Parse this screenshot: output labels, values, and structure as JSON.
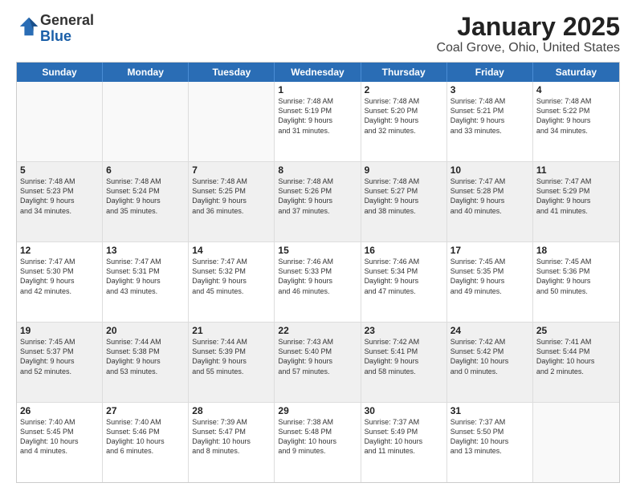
{
  "header": {
    "logo_general": "General",
    "logo_blue": "Blue",
    "title": "January 2025",
    "subtitle": "Coal Grove, Ohio, United States"
  },
  "calendar": {
    "days_of_week": [
      "Sunday",
      "Monday",
      "Tuesday",
      "Wednesday",
      "Thursday",
      "Friday",
      "Saturday"
    ],
    "rows": [
      [
        {
          "day": "",
          "lines": []
        },
        {
          "day": "",
          "lines": []
        },
        {
          "day": "",
          "lines": []
        },
        {
          "day": "1",
          "lines": [
            "Sunrise: 7:48 AM",
            "Sunset: 5:19 PM",
            "Daylight: 9 hours",
            "and 31 minutes."
          ]
        },
        {
          "day": "2",
          "lines": [
            "Sunrise: 7:48 AM",
            "Sunset: 5:20 PM",
            "Daylight: 9 hours",
            "and 32 minutes."
          ]
        },
        {
          "day": "3",
          "lines": [
            "Sunrise: 7:48 AM",
            "Sunset: 5:21 PM",
            "Daylight: 9 hours",
            "and 33 minutes."
          ]
        },
        {
          "day": "4",
          "lines": [
            "Sunrise: 7:48 AM",
            "Sunset: 5:22 PM",
            "Daylight: 9 hours",
            "and 34 minutes."
          ]
        }
      ],
      [
        {
          "day": "5",
          "lines": [
            "Sunrise: 7:48 AM",
            "Sunset: 5:23 PM",
            "Daylight: 9 hours",
            "and 34 minutes."
          ]
        },
        {
          "day": "6",
          "lines": [
            "Sunrise: 7:48 AM",
            "Sunset: 5:24 PM",
            "Daylight: 9 hours",
            "and 35 minutes."
          ]
        },
        {
          "day": "7",
          "lines": [
            "Sunrise: 7:48 AM",
            "Sunset: 5:25 PM",
            "Daylight: 9 hours",
            "and 36 minutes."
          ]
        },
        {
          "day": "8",
          "lines": [
            "Sunrise: 7:48 AM",
            "Sunset: 5:26 PM",
            "Daylight: 9 hours",
            "and 37 minutes."
          ]
        },
        {
          "day": "9",
          "lines": [
            "Sunrise: 7:48 AM",
            "Sunset: 5:27 PM",
            "Daylight: 9 hours",
            "and 38 minutes."
          ]
        },
        {
          "day": "10",
          "lines": [
            "Sunrise: 7:47 AM",
            "Sunset: 5:28 PM",
            "Daylight: 9 hours",
            "and 40 minutes."
          ]
        },
        {
          "day": "11",
          "lines": [
            "Sunrise: 7:47 AM",
            "Sunset: 5:29 PM",
            "Daylight: 9 hours",
            "and 41 minutes."
          ]
        }
      ],
      [
        {
          "day": "12",
          "lines": [
            "Sunrise: 7:47 AM",
            "Sunset: 5:30 PM",
            "Daylight: 9 hours",
            "and 42 minutes."
          ]
        },
        {
          "day": "13",
          "lines": [
            "Sunrise: 7:47 AM",
            "Sunset: 5:31 PM",
            "Daylight: 9 hours",
            "and 43 minutes."
          ]
        },
        {
          "day": "14",
          "lines": [
            "Sunrise: 7:47 AM",
            "Sunset: 5:32 PM",
            "Daylight: 9 hours",
            "and 45 minutes."
          ]
        },
        {
          "day": "15",
          "lines": [
            "Sunrise: 7:46 AM",
            "Sunset: 5:33 PM",
            "Daylight: 9 hours",
            "and 46 minutes."
          ]
        },
        {
          "day": "16",
          "lines": [
            "Sunrise: 7:46 AM",
            "Sunset: 5:34 PM",
            "Daylight: 9 hours",
            "and 47 minutes."
          ]
        },
        {
          "day": "17",
          "lines": [
            "Sunrise: 7:45 AM",
            "Sunset: 5:35 PM",
            "Daylight: 9 hours",
            "and 49 minutes."
          ]
        },
        {
          "day": "18",
          "lines": [
            "Sunrise: 7:45 AM",
            "Sunset: 5:36 PM",
            "Daylight: 9 hours",
            "and 50 minutes."
          ]
        }
      ],
      [
        {
          "day": "19",
          "lines": [
            "Sunrise: 7:45 AM",
            "Sunset: 5:37 PM",
            "Daylight: 9 hours",
            "and 52 minutes."
          ]
        },
        {
          "day": "20",
          "lines": [
            "Sunrise: 7:44 AM",
            "Sunset: 5:38 PM",
            "Daylight: 9 hours",
            "and 53 minutes."
          ]
        },
        {
          "day": "21",
          "lines": [
            "Sunrise: 7:44 AM",
            "Sunset: 5:39 PM",
            "Daylight: 9 hours",
            "and 55 minutes."
          ]
        },
        {
          "day": "22",
          "lines": [
            "Sunrise: 7:43 AM",
            "Sunset: 5:40 PM",
            "Daylight: 9 hours",
            "and 57 minutes."
          ]
        },
        {
          "day": "23",
          "lines": [
            "Sunrise: 7:42 AM",
            "Sunset: 5:41 PM",
            "Daylight: 9 hours",
            "and 58 minutes."
          ]
        },
        {
          "day": "24",
          "lines": [
            "Sunrise: 7:42 AM",
            "Sunset: 5:42 PM",
            "Daylight: 10 hours",
            "and 0 minutes."
          ]
        },
        {
          "day": "25",
          "lines": [
            "Sunrise: 7:41 AM",
            "Sunset: 5:44 PM",
            "Daylight: 10 hours",
            "and 2 minutes."
          ]
        }
      ],
      [
        {
          "day": "26",
          "lines": [
            "Sunrise: 7:40 AM",
            "Sunset: 5:45 PM",
            "Daylight: 10 hours",
            "and 4 minutes."
          ]
        },
        {
          "day": "27",
          "lines": [
            "Sunrise: 7:40 AM",
            "Sunset: 5:46 PM",
            "Daylight: 10 hours",
            "and 6 minutes."
          ]
        },
        {
          "day": "28",
          "lines": [
            "Sunrise: 7:39 AM",
            "Sunset: 5:47 PM",
            "Daylight: 10 hours",
            "and 8 minutes."
          ]
        },
        {
          "day": "29",
          "lines": [
            "Sunrise: 7:38 AM",
            "Sunset: 5:48 PM",
            "Daylight: 10 hours",
            "and 9 minutes."
          ]
        },
        {
          "day": "30",
          "lines": [
            "Sunrise: 7:37 AM",
            "Sunset: 5:49 PM",
            "Daylight: 10 hours",
            "and 11 minutes."
          ]
        },
        {
          "day": "31",
          "lines": [
            "Sunrise: 7:37 AM",
            "Sunset: 5:50 PM",
            "Daylight: 10 hours",
            "and 13 minutes."
          ]
        },
        {
          "day": "",
          "lines": []
        }
      ]
    ]
  }
}
